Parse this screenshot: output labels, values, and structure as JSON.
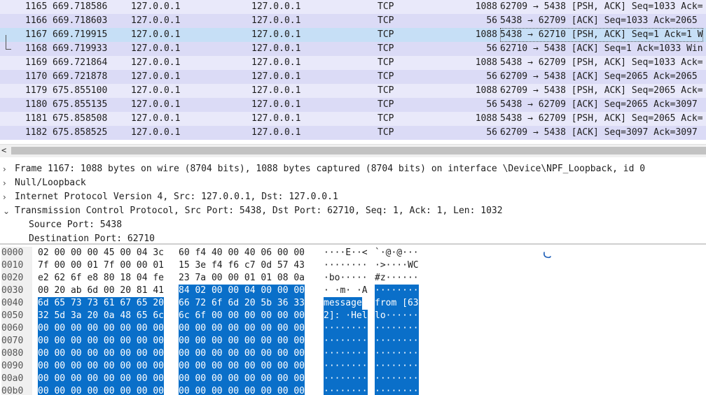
{
  "packet_list": {
    "rows": [
      {
        "no": "1165",
        "time": "669.718586",
        "src": "127.0.0.1",
        "dst": "127.0.0.1",
        "proto": "TCP",
        "len": "1088",
        "info": "62709 → 5438 [PSH, ACK] Seq=1033 Ack="
      },
      {
        "no": "1166",
        "time": "669.718603",
        "src": "127.0.0.1",
        "dst": "127.0.0.1",
        "proto": "TCP",
        "len": "56",
        "info": "5438 → 62709 [ACK] Seq=1033 Ack=2065"
      },
      {
        "no": "1167",
        "time": "669.719915",
        "src": "127.0.0.1",
        "dst": "127.0.0.1",
        "proto": "TCP",
        "len": "1088",
        "info": "5438 → 62710 [PSH, ACK] Seq=1 Ack=1 W"
      },
      {
        "no": "1168",
        "time": "669.719933",
        "src": "127.0.0.1",
        "dst": "127.0.0.1",
        "proto": "TCP",
        "len": "56",
        "info": "62710 → 5438 [ACK] Seq=1 Ack=1033 Win"
      },
      {
        "no": "1169",
        "time": "669.721864",
        "src": "127.0.0.1",
        "dst": "127.0.0.1",
        "proto": "TCP",
        "len": "1088",
        "info": "5438 → 62709 [PSH, ACK] Seq=1033 Ack="
      },
      {
        "no": "1170",
        "time": "669.721878",
        "src": "127.0.0.1",
        "dst": "127.0.0.1",
        "proto": "TCP",
        "len": "56",
        "info": "62709 → 5438 [ACK] Seq=2065 Ack=2065"
      },
      {
        "no": "1179",
        "time": "675.855100",
        "src": "127.0.0.1",
        "dst": "127.0.0.1",
        "proto": "TCP",
        "len": "1088",
        "info": "62709 → 5438 [PSH, ACK] Seq=2065 Ack="
      },
      {
        "no": "1180",
        "time": "675.855135",
        "src": "127.0.0.1",
        "dst": "127.0.0.1",
        "proto": "TCP",
        "len": "56",
        "info": "5438 → 62709 [ACK] Seq=2065 Ack=3097"
      },
      {
        "no": "1181",
        "time": "675.858508",
        "src": "127.0.0.1",
        "dst": "127.0.0.1",
        "proto": "TCP",
        "len": "1088",
        "info": "5438 → 62709 [PSH, ACK] Seq=2065 Ack="
      },
      {
        "no": "1182",
        "time": "675.858525",
        "src": "127.0.0.1",
        "dst": "127.0.0.1",
        "proto": "TCP",
        "len": "56",
        "info": "62709 → 5438 [ACK] Seq=3097 Ack=3097"
      }
    ],
    "selected_no": "1167"
  },
  "scrollbar": {
    "left_arrow": "<"
  },
  "detail": {
    "items": [
      {
        "expanded": false,
        "text": "Frame 1167: 1088 bytes on wire (8704 bits), 1088 bytes captured (8704 bits) on interface \\Device\\NPF_Loopback, id 0"
      },
      {
        "expanded": false,
        "text": "Null/Loopback"
      },
      {
        "expanded": false,
        "text": "Internet Protocol Version 4, Src: 127.0.0.1, Dst: 127.0.0.1"
      },
      {
        "expanded": true,
        "text": "Transmission Control Protocol, Src Port: 5438, Dst Port: 62710, Seq: 1, Ack: 1, Len: 1032"
      }
    ],
    "children": [
      "Source Port: 5438",
      "Destination Port: 62710"
    ],
    "chevron_collapsed": "›",
    "chevron_expanded": "⌄"
  },
  "bytes": {
    "rows": [
      {
        "offset": "0000",
        "hex1": "02 00 00 00 45 00 04 3c",
        "hex2": "60 f4 40 00 40 06 00 00",
        "ascii1": "····E··<",
        "ascii2": "`·@·@···"
      },
      {
        "offset": "0010",
        "hex1": "7f 00 00 01 7f 00 00 01",
        "hex2": "15 3e f4 f6 c7 0d 57 43",
        "ascii1": "········",
        "ascii2": "·>····WC"
      },
      {
        "offset": "0020",
        "hex1": "e2 62 6f e8 80 18 04 fe",
        "hex2": "23 7a 00 00 01 01 08 0a",
        "ascii1": "·bo·····",
        "ascii2": "#z······"
      },
      {
        "offset": "0030",
        "hex1": "00 20 ab 6d 00 20 81 41",
        "hex2": "84 02 00 00 04 00 00 00",
        "ascii1": "· ·m· ·A",
        "ascii2": "········"
      },
      {
        "offset": "0040",
        "hex1": "6d 65 73 73 61 67 65 20",
        "hex2": "66 72 6f 6d 20 5b 36 33",
        "ascii1": "message ",
        "ascii2": "from [63"
      },
      {
        "offset": "0050",
        "hex1": "32 5d 3a 20 0a 48 65 6c",
        "hex2": "6c 6f 00 00 00 00 00 00",
        "ascii1": "2]: ·Hel",
        "ascii2": "lo······"
      },
      {
        "offset": "0060",
        "hex1": "00 00 00 00 00 00 00 00",
        "hex2": "00 00 00 00 00 00 00 00",
        "ascii1": "········",
        "ascii2": "········"
      },
      {
        "offset": "0070",
        "hex1": "00 00 00 00 00 00 00 00",
        "hex2": "00 00 00 00 00 00 00 00",
        "ascii1": "········",
        "ascii2": "········"
      },
      {
        "offset": "0080",
        "hex1": "00 00 00 00 00 00 00 00",
        "hex2": "00 00 00 00 00 00 00 00",
        "ascii1": "········",
        "ascii2": "········"
      },
      {
        "offset": "0090",
        "hex1": "00 00 00 00 00 00 00 00",
        "hex2": "00 00 00 00 00 00 00 00",
        "ascii1": "········",
        "ascii2": "········"
      },
      {
        "offset": "00a0",
        "hex1": "00 00 00 00 00 00 00 00",
        "hex2": "00 00 00 00 00 00 00 00",
        "ascii1": "········",
        "ascii2": "········"
      },
      {
        "offset": "00b0",
        "hex1": "00 00 00 00 00 00 00 00",
        "hex2": "00 00 00 00 00 00 00 00",
        "ascii1": "········",
        "ascii2": "········"
      }
    ],
    "highlight_start_row": 3,
    "highlight_color": "#0a6fc9"
  },
  "icons": {
    "mouse_cursor": "busy-cursor-icon"
  }
}
